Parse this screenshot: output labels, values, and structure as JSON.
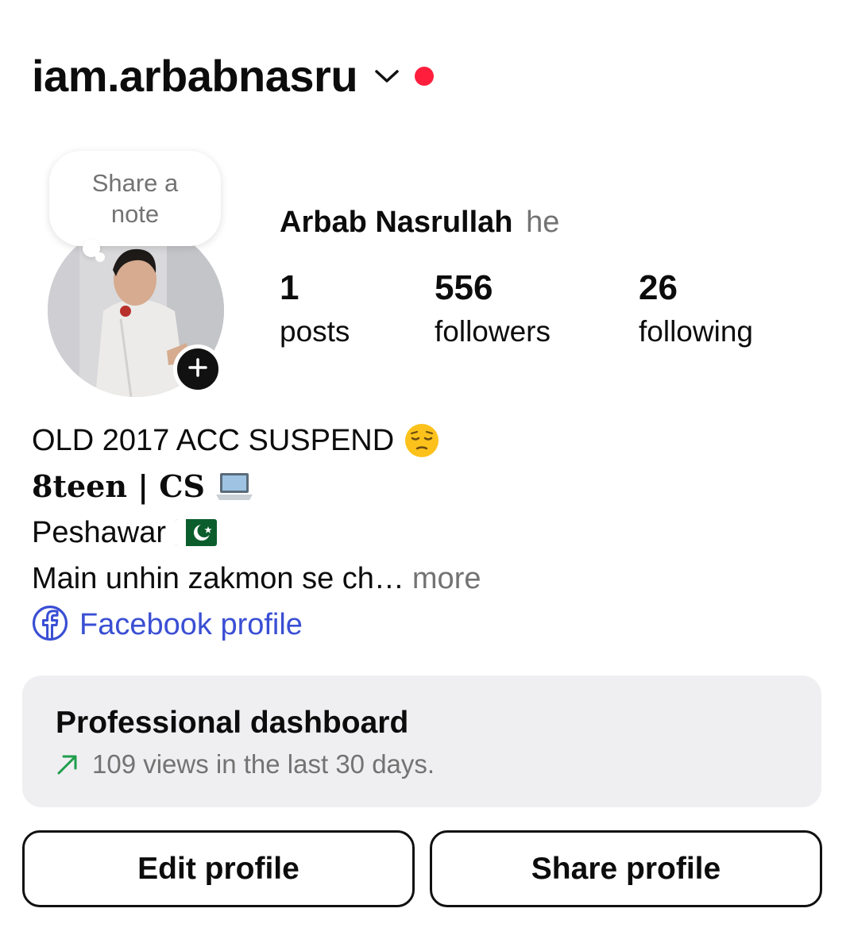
{
  "header": {
    "username": "iam.arbabnasru",
    "switch_icon": "chevron-down-icon",
    "notification_dot_color": "#ff1f3d"
  },
  "note": {
    "text": "Share a note"
  },
  "avatar": {
    "add_icon": "plus-icon"
  },
  "profile": {
    "name": "Arbab Nasrullah",
    "pronouns": "he"
  },
  "stats": {
    "posts": {
      "count": "1",
      "label": "posts"
    },
    "followers": {
      "count": "556",
      "label": "followers"
    },
    "following": {
      "count": "26",
      "label": "following"
    }
  },
  "bio": {
    "line1": "OLD 2017 ACC SUSPEND",
    "line1_emoji": "pensive-face-emoji",
    "line2": "8teen | CS",
    "line2_emoji": "laptop-emoji",
    "line3": "Peshawar",
    "line3_emoji": "pakistan-flag-emoji",
    "line4": "Main unhin zakmon se ch…",
    "more_label": "more",
    "link": {
      "icon": "facebook-icon",
      "label": "Facebook profile",
      "color": "#3a4fd4"
    }
  },
  "dashboard": {
    "title": "Professional dashboard",
    "subtitle": "109 views in the last 30 days.",
    "trend_icon": "trend-up-arrow-icon",
    "trend_color": "#1f9d4c"
  },
  "actions": {
    "edit_label": "Edit profile",
    "share_label": "Share profile"
  }
}
